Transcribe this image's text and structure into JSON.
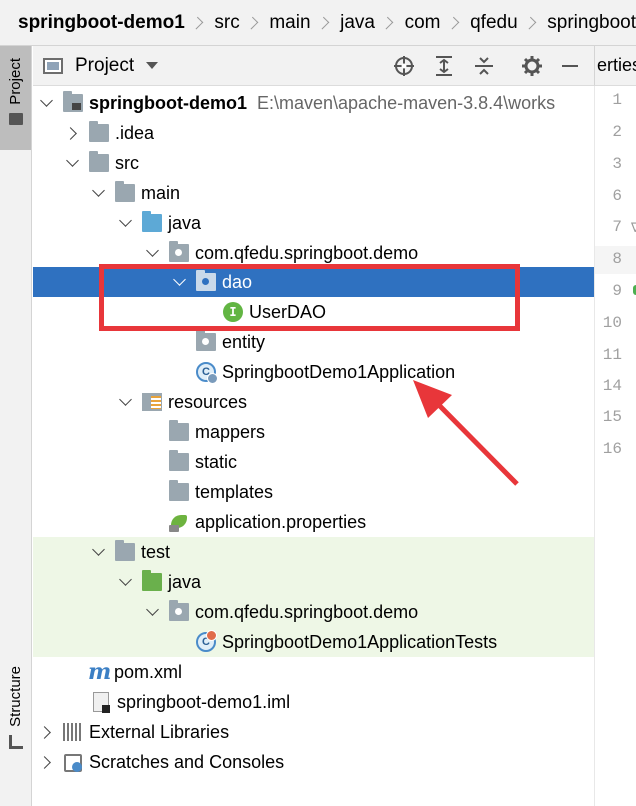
{
  "breadcrumb": [
    "springboot-demo1",
    "src",
    "main",
    "java",
    "com",
    "qfedu",
    "springboot"
  ],
  "left_stripe": {
    "project_tab": "Project",
    "structure_tab": "Structure"
  },
  "project_panel": {
    "title": "Project",
    "tools": [
      "target-icon",
      "expand-all-icon",
      "collapse-all-icon",
      "gear-icon",
      "minimize-icon"
    ]
  },
  "editor": {
    "tab_label": "erties",
    "line_numbers": [
      "1",
      "2",
      "3",
      "6",
      "7",
      "8",
      "9",
      "10",
      "11",
      "14",
      "15",
      "16"
    ],
    "current_line": "8"
  },
  "tree": {
    "root": {
      "label": "springboot-demo1",
      "path": "E:\\maven\\apache-maven-3.8.4\\works"
    },
    "idea": ".idea",
    "src": "src",
    "main": "main",
    "java": "java",
    "package": "com.qfedu.springboot.demo",
    "dao": "dao",
    "userdao": "UserDAO",
    "userdao_badge": "I",
    "entity": "entity",
    "app_class": "SpringbootDemo1Application",
    "class_badge": "C",
    "resources": "resources",
    "mappers": "mappers",
    "static": "static",
    "templates": "templates",
    "app_props": "application.properties",
    "test": "test",
    "test_java": "java",
    "test_package": "com.qfedu.springboot.demo",
    "test_class": "SpringbootDemo1ApplicationTests",
    "pom": "pom.xml",
    "iml": "springboot-demo1.iml",
    "external_libraries": "External Libraries",
    "scratches": "Scratches and Consoles"
  },
  "colors": {
    "selection": "#2f71c0",
    "annotation": "#e8363a",
    "test_bg": "#eef7e6"
  }
}
